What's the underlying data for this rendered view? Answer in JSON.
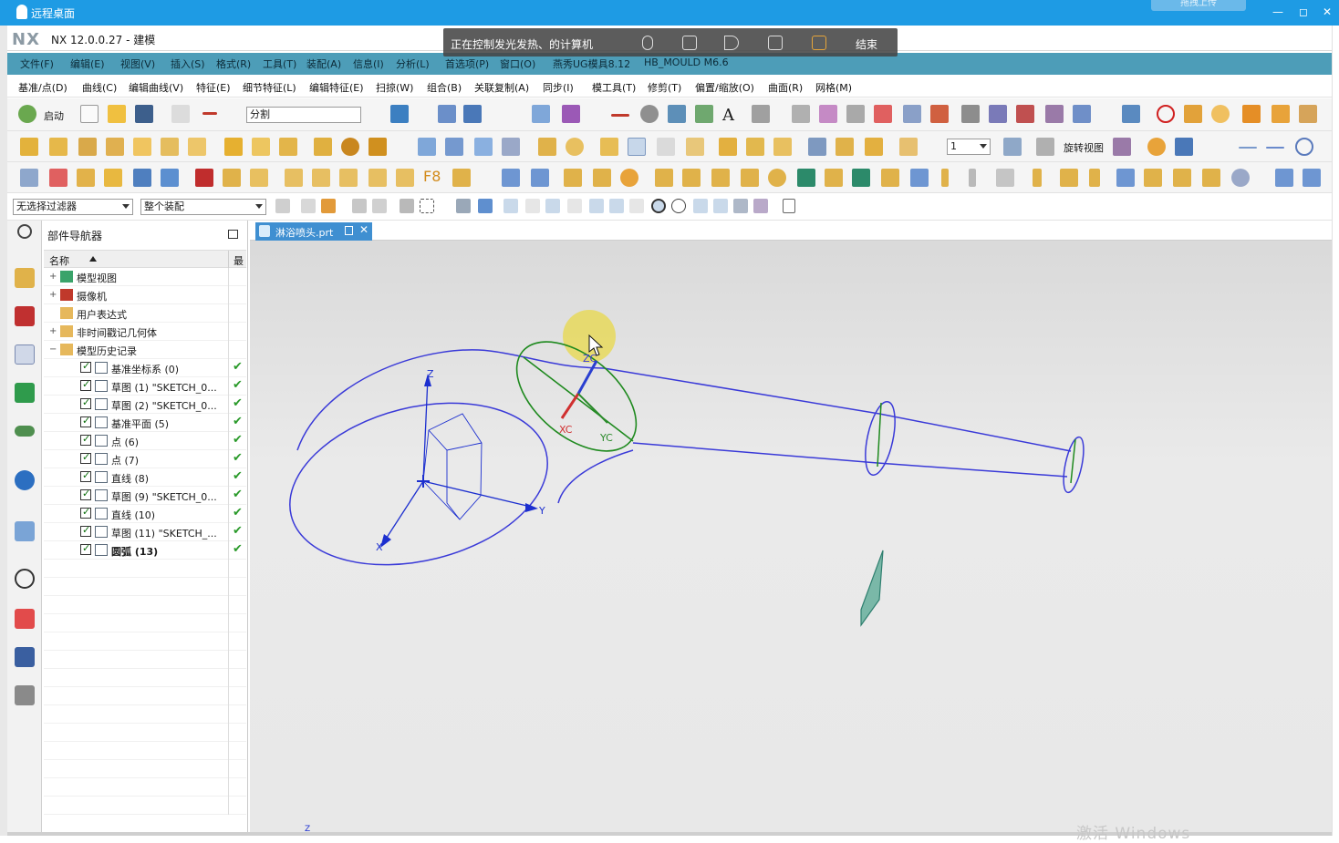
{
  "remote_desktop": {
    "title": "远程桌面",
    "upload_btn": "拖拽上传",
    "overlay_msg": "正在控制发光发热、的计算机",
    "end_label": "结束"
  },
  "app": {
    "logo": "NX",
    "title": "NX 12.0.0.27 - 建模"
  },
  "menu": [
    "文件(F)",
    "编辑(E)",
    "视图(V)",
    "插入(S)",
    "格式(R)",
    "工具(T)",
    "装配(A)",
    "信息(I)",
    "分析(L)",
    "首选项(P)",
    "窗口(O)",
    "燕秀UG模具8.12",
    "HB_MOULD M6.6"
  ],
  "command_groups": [
    "基准/点(D)",
    "曲线(C)",
    "编辑曲线(V)",
    "特征(E)",
    "细节特征(L)",
    "编辑特征(E)",
    "扫掠(W)",
    "组合(B)",
    "关联复制(A)",
    "同步(I)",
    "模工具(T)",
    "修剪(T)",
    "偏置/缩放(O)",
    "曲面(R)",
    "网格(M)"
  ],
  "toolbar": {
    "start_label": "启动",
    "search_value": "分割",
    "layer_value": "1",
    "rotate_view_label": "旋转视图",
    "filter_value": "无选择过滤器",
    "assembly_value": "整个装配"
  },
  "navigator": {
    "title": "部件导航器",
    "col_name": "名称",
    "col_latest": "最",
    "items": [
      {
        "label": "模型视图",
        "indent": 0,
        "expander": "+",
        "check": false,
        "ok": false
      },
      {
        "label": "摄像机",
        "indent": 0,
        "expander": "+",
        "check": false,
        "ok": false
      },
      {
        "label": "用户表达式",
        "indent": 0,
        "expander": "",
        "check": false,
        "ok": false
      },
      {
        "label": "非时间戳记几何体",
        "indent": 0,
        "expander": "+",
        "check": false,
        "ok": false
      },
      {
        "label": "模型历史记录",
        "indent": 0,
        "expander": "−",
        "check": false,
        "ok": false
      },
      {
        "label": "基准坐标系 (0)",
        "indent": 1,
        "expander": "",
        "check": true,
        "ok": true
      },
      {
        "label": "草图 (1) \"SKETCH_0...",
        "indent": 1,
        "expander": "",
        "check": true,
        "ok": true
      },
      {
        "label": "草图 (2) \"SKETCH_0...",
        "indent": 1,
        "expander": "",
        "check": true,
        "ok": true
      },
      {
        "label": "基准平面 (5)",
        "indent": 1,
        "expander": "",
        "check": true,
        "ok": true
      },
      {
        "label": "点 (6)",
        "indent": 1,
        "expander": "",
        "check": true,
        "ok": true
      },
      {
        "label": "点 (7)",
        "indent": 1,
        "expander": "",
        "check": true,
        "ok": true
      },
      {
        "label": "直线 (8)",
        "indent": 1,
        "expander": "",
        "check": true,
        "ok": true
      },
      {
        "label": "草图 (9) \"SKETCH_0...",
        "indent": 1,
        "expander": "",
        "check": true,
        "ok": true
      },
      {
        "label": "直线 (10)",
        "indent": 1,
        "expander": "",
        "check": true,
        "ok": true
      },
      {
        "label": "草图 (11) \"SKETCH_...",
        "indent": 1,
        "expander": "",
        "check": true,
        "ok": true
      },
      {
        "label": "圆弧 (13)",
        "indent": 1,
        "expander": "",
        "check": true,
        "ok": true,
        "bold": true
      }
    ]
  },
  "viewport": {
    "tab_label": "淋浴喷头.prt",
    "close": "✕",
    "axis_z": "Z",
    "axis_y": "Y",
    "axis_x": "X",
    "wcs_zc": "ZC",
    "wcs_xc": "XC",
    "wcs_yc": "YC",
    "watermark": "激活 Windows"
  },
  "colors": {
    "remote_bar": "#1e9be4",
    "menubar": "#4d9db8",
    "sketch_blue": "#3a3ad8",
    "sketch_green": "#1f8a1f",
    "tab_active": "#3f8fd1"
  }
}
